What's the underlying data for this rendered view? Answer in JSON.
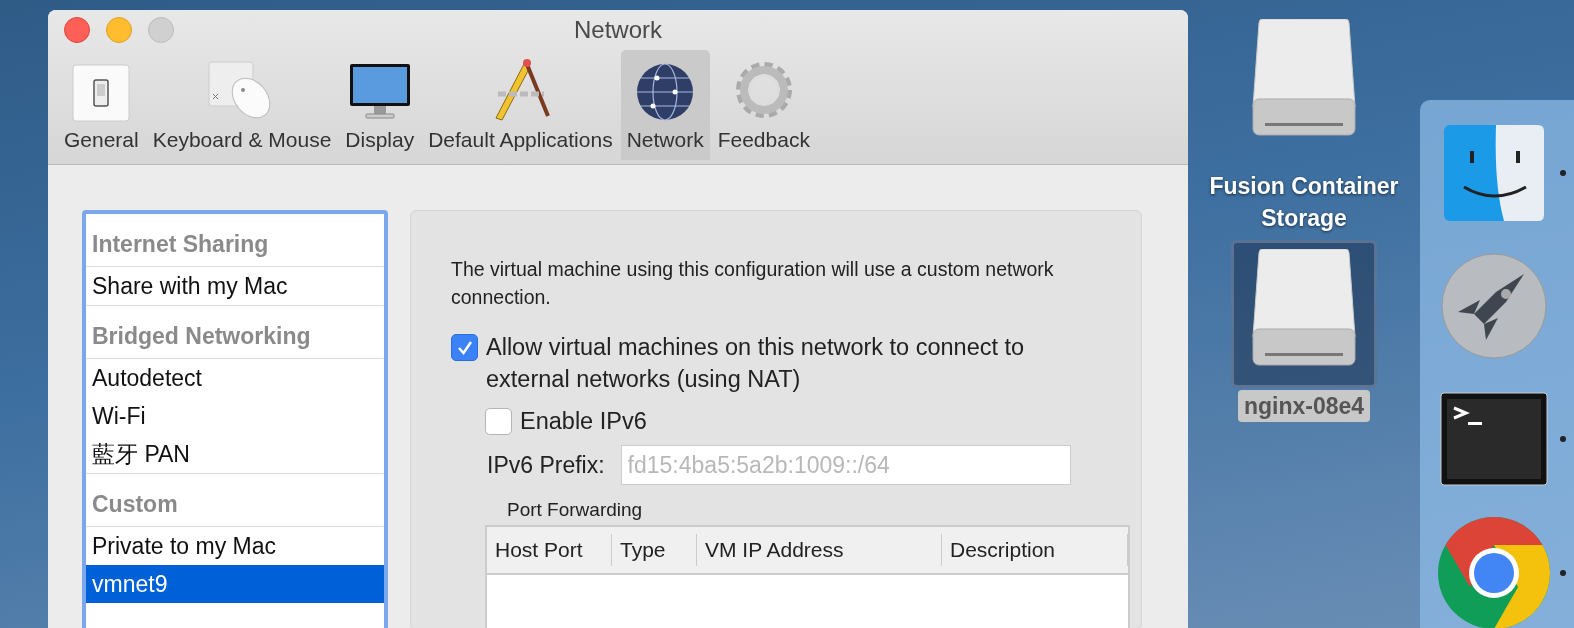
{
  "window": {
    "title": "Network"
  },
  "toolbar": {
    "items": [
      {
        "label": "General",
        "selected": false
      },
      {
        "label": "Keyboard & Mouse",
        "selected": false
      },
      {
        "label": "Display",
        "selected": false
      },
      {
        "label": "Default Applications",
        "selected": false
      },
      {
        "label": "Network",
        "selected": true
      },
      {
        "label": "Feedback",
        "selected": false
      }
    ]
  },
  "sidebar": {
    "items": [
      {
        "kind": "header",
        "label": "Internet Sharing",
        "selected": false
      },
      {
        "kind": "item",
        "label": "Share with my Mac",
        "selected": false
      },
      {
        "kind": "header",
        "label": "Bridged Networking",
        "selected": false
      },
      {
        "kind": "item",
        "label": "Autodetect",
        "selected": false
      },
      {
        "kind": "item",
        "label": "Wi-Fi",
        "selected": false
      },
      {
        "kind": "item",
        "label": "藍牙 PAN",
        "selected": false
      },
      {
        "kind": "header",
        "label": "Custom",
        "selected": false
      },
      {
        "kind": "item",
        "label": "Private to my Mac",
        "selected": false
      },
      {
        "kind": "item",
        "label": "vmnet9",
        "selected": true
      }
    ]
  },
  "panel": {
    "description": "The virtual machine using this configuration will use a custom network connection.",
    "nat": {
      "label": "Allow virtual machines on this network to connect to external networks (using NAT)",
      "checked": true
    },
    "ipv6": {
      "label": "Enable IPv6",
      "checked": false
    },
    "ipv6_prefix": {
      "label": "IPv6 Prefix:",
      "placeholder": "fd15:4ba5:5a2b:1009::/64"
    },
    "port_forwarding": {
      "title": "Port Forwarding",
      "columns": [
        "Host Port",
        "Type",
        "VM IP Address",
        "Description"
      ]
    }
  },
  "desktop": {
    "icons": [
      {
        "label": "Fusion Container Storage",
        "selected": false
      },
      {
        "label": "nginx-08e4",
        "selected": true
      }
    ]
  },
  "dock": {
    "apps": [
      {
        "running": true
      },
      {
        "running": false
      },
      {
        "running": true
      },
      {
        "running": true
      }
    ]
  }
}
